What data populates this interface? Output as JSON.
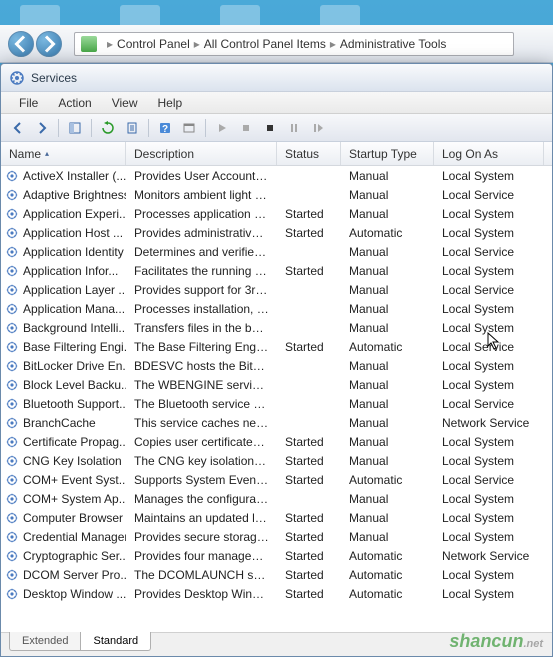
{
  "breadcrumb": {
    "items": [
      "Control Panel",
      "All Control Panel Items",
      "Administrative Tools"
    ]
  },
  "window": {
    "title": "Services"
  },
  "menu": {
    "file": "File",
    "action": "Action",
    "view": "View",
    "help": "Help"
  },
  "columns": {
    "name": "Name",
    "description": "Description",
    "status": "Status",
    "startup": "Startup Type",
    "logon": "Log On As"
  },
  "tabs": {
    "extended": "Extended",
    "standard": "Standard"
  },
  "services": [
    {
      "name": "ActiveX Installer (...",
      "desc": "Provides User Account C...",
      "status": "",
      "startup": "Manual",
      "logon": "Local System"
    },
    {
      "name": "Adaptive Brightness",
      "desc": "Monitors ambient light s...",
      "status": "",
      "startup": "Manual",
      "logon": "Local Service"
    },
    {
      "name": "Application Experi...",
      "desc": "Processes application co...",
      "status": "Started",
      "startup": "Manual",
      "logon": "Local System"
    },
    {
      "name": "Application Host ...",
      "desc": "Provides administrative s...",
      "status": "Started",
      "startup": "Automatic",
      "logon": "Local System"
    },
    {
      "name": "Application Identity",
      "desc": "Determines and verifies t...",
      "status": "",
      "startup": "Manual",
      "logon": "Local Service"
    },
    {
      "name": "Application Infor...",
      "desc": "Facilitates the running of...",
      "status": "Started",
      "startup": "Manual",
      "logon": "Local System"
    },
    {
      "name": "Application Layer ...",
      "desc": "Provides support for 3rd ...",
      "status": "",
      "startup": "Manual",
      "logon": "Local Service"
    },
    {
      "name": "Application Mana...",
      "desc": "Processes installation, re...",
      "status": "",
      "startup": "Manual",
      "logon": "Local System"
    },
    {
      "name": "Background Intelli...",
      "desc": "Transfers files in the bac...",
      "status": "",
      "startup": "Manual",
      "logon": "Local System"
    },
    {
      "name": "Base Filtering Engi...",
      "desc": "The Base Filtering Engine...",
      "status": "Started",
      "startup": "Automatic",
      "logon": "Local Service"
    },
    {
      "name": "BitLocker Drive En...",
      "desc": "BDESVC hosts the BitLoc...",
      "status": "",
      "startup": "Manual",
      "logon": "Local System"
    },
    {
      "name": "Block Level Backu...",
      "desc": "The WBENGINE service is...",
      "status": "",
      "startup": "Manual",
      "logon": "Local System"
    },
    {
      "name": "Bluetooth Support...",
      "desc": "The Bluetooth service su...",
      "status": "",
      "startup": "Manual",
      "logon": "Local Service"
    },
    {
      "name": "BranchCache",
      "desc": "This service caches netw...",
      "status": "",
      "startup": "Manual",
      "logon": "Network Service"
    },
    {
      "name": "Certificate Propag...",
      "desc": "Copies user certificates a...",
      "status": "Started",
      "startup": "Manual",
      "logon": "Local System"
    },
    {
      "name": "CNG Key Isolation",
      "desc": "The CNG key isolation se...",
      "status": "Started",
      "startup": "Manual",
      "logon": "Local System"
    },
    {
      "name": "COM+ Event Syst...",
      "desc": "Supports System Event N...",
      "status": "Started",
      "startup": "Automatic",
      "logon": "Local Service"
    },
    {
      "name": "COM+ System Ap...",
      "desc": "Manages the configurati...",
      "status": "",
      "startup": "Manual",
      "logon": "Local System"
    },
    {
      "name": "Computer Browser",
      "desc": "Maintains an updated lis...",
      "status": "Started",
      "startup": "Manual",
      "logon": "Local System"
    },
    {
      "name": "Credential Manager",
      "desc": "Provides secure storage ...",
      "status": "Started",
      "startup": "Manual",
      "logon": "Local System"
    },
    {
      "name": "Cryptographic Ser...",
      "desc": "Provides four managem...",
      "status": "Started",
      "startup": "Automatic",
      "logon": "Network Service"
    },
    {
      "name": "DCOM Server Pro...",
      "desc": "The DCOMLAUNCH serv...",
      "status": "Started",
      "startup": "Automatic",
      "logon": "Local System"
    },
    {
      "name": "Desktop Window ...",
      "desc": "Provides Desktop Windo...",
      "status": "Started",
      "startup": "Automatic",
      "logon": "Local System"
    }
  ],
  "watermark": {
    "main": "shancun",
    "sub": ".net"
  }
}
